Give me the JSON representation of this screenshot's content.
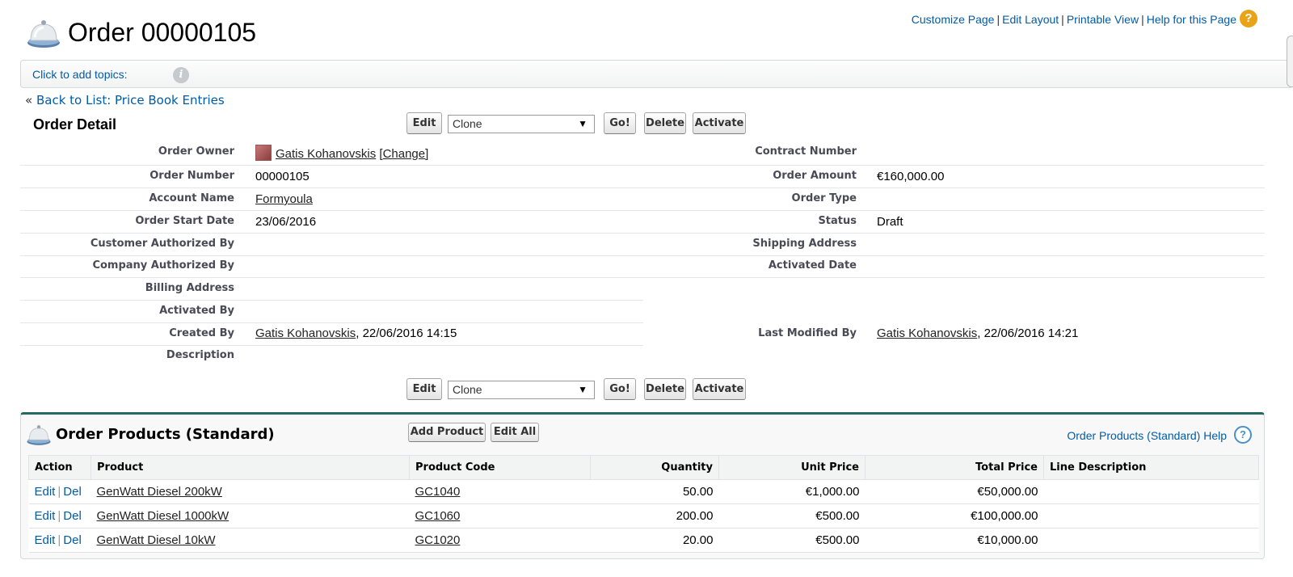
{
  "header": {
    "title": "Order 00000105",
    "links": [
      "Customize Page",
      "Edit Layout",
      "Printable View",
      "Help for this Page"
    ],
    "help_icon": "?"
  },
  "topics": {
    "label": "Click to add topics:",
    "info_icon": "i"
  },
  "back": {
    "prefix": "«",
    "label": "Back to List: Price Book Entries"
  },
  "detail": {
    "section_title": "Order Detail",
    "buttons": {
      "edit": "Edit",
      "clone": "Clone",
      "go": "Go!",
      "delete": "Delete",
      "activate": "Activate"
    },
    "left": [
      {
        "label": "Order Owner",
        "value": "Gatis Kohanovskis",
        "extra": "[Change]"
      },
      {
        "label": "Order Number",
        "value": "00000105"
      },
      {
        "label": "Account Name",
        "value": "Formyoula"
      },
      {
        "label": "Order Start Date",
        "value": "23/06/2016"
      },
      {
        "label": "Customer Authorized By",
        "value": ""
      },
      {
        "label": "Company Authorized By",
        "value": ""
      },
      {
        "label": "Billing Address",
        "value": ""
      },
      {
        "label": "Activated By",
        "value": ""
      },
      {
        "label": "Created By",
        "value": "Gatis Kohanovskis",
        "extra": ", 22/06/2016 14:15"
      },
      {
        "label": "Description",
        "value": ""
      }
    ],
    "right": [
      {
        "label": "Contract Number",
        "value": ""
      },
      {
        "label": "Order Amount",
        "value": "€160,000.00"
      },
      {
        "label": "Order Type",
        "value": ""
      },
      {
        "label": "Status",
        "value": "Draft"
      },
      {
        "label": "Shipping Address",
        "value": ""
      },
      {
        "label": "Activated Date",
        "value": ""
      },
      {
        "label": "Last Modified By",
        "value": "Gatis Kohanovskis",
        "extra": ", 22/06/2016 14:21"
      }
    ]
  },
  "products": {
    "title": "Order Products (Standard)",
    "add_button": "Add Product",
    "edit_all_button": "Edit All",
    "help_link": "Order Products (Standard) Help",
    "help_icon": "?",
    "columns": [
      "Action",
      "Product",
      "Product Code",
      "Quantity",
      "Unit Price",
      "Total Price",
      "Line Description"
    ],
    "action_edit": "Edit",
    "action_sep": "|",
    "action_del": "Del",
    "rows": [
      {
        "product": "GenWatt Diesel 200kW",
        "code": "GC1040",
        "quantity": "50.00",
        "unit_price": "€1,000.00",
        "total_price": "€50,000.00",
        "description": ""
      },
      {
        "product": "GenWatt Diesel 1000kW",
        "code": "GC1060",
        "quantity": "200.00",
        "unit_price": "€500.00",
        "total_price": "€100,000.00",
        "description": ""
      },
      {
        "product": "GenWatt Diesel 10kW",
        "code": "GC1020",
        "quantity": "20.00",
        "unit_price": "€500.00",
        "total_price": "€10,000.00",
        "description": ""
      }
    ]
  }
}
